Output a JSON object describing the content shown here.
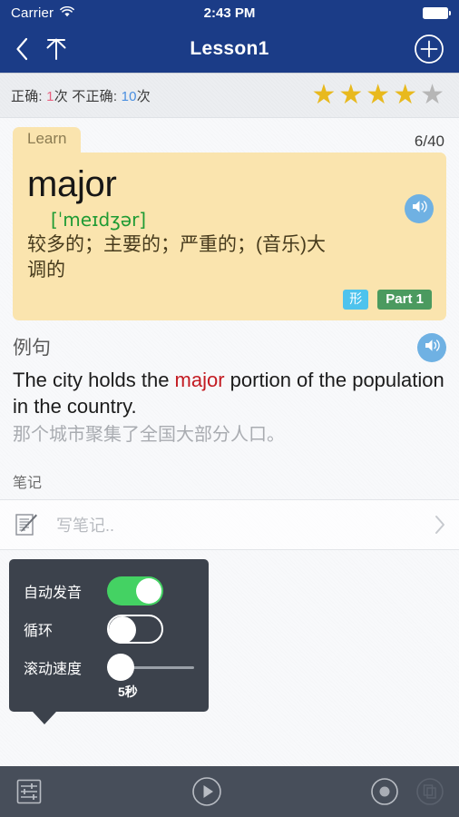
{
  "statusbar": {
    "carrier": "Carrier",
    "wifi_icon": "wifi-icon",
    "time": "2:43 PM",
    "battery_icon": "battery-full-icon"
  },
  "navbar": {
    "back_icon": "chevron-left-icon",
    "up_icon": "arrow-up-icon",
    "title": "Lesson1",
    "add_icon": "plus-circle-icon"
  },
  "stats": {
    "correct_label": "正确: ",
    "correct_count": "1",
    "correct_unit": "次 ",
    "wrong_label": "不正确: ",
    "wrong_count": "10",
    "wrong_unit": "次",
    "stars_filled": 4,
    "stars_total": 5,
    "star_glyph": "★",
    "star_color": "#e8b91e",
    "star_off_color": "#b6b6b6"
  },
  "card": {
    "tab_label": "Learn",
    "counter": "6/40",
    "word": "major",
    "phonetic": "[ˈmeɪdʒər]",
    "definition": "较多的；主要的；严重的；(音乐)大调的",
    "pos_tag": "形",
    "part_tag": "Part 1",
    "speaker_icon": "speaker-icon",
    "bg_color": "#fae4ae",
    "pos_tag_color": "#4ec3ed",
    "part_tag_color": "#4b9a5f"
  },
  "example": {
    "heading": "例句",
    "speaker_icon": "speaker-icon",
    "sentence_before": "The city holds the ",
    "sentence_highlight": "major",
    "sentence_after": " portion of the population in the country.",
    "translation": "那个城市聚集了全国大部分人口。",
    "highlight_color": "#c31b22"
  },
  "notes": {
    "heading": "笔记",
    "note_icon": "note-pencil-icon",
    "placeholder": "写笔记..",
    "chevron_icon": "chevron-right-icon"
  },
  "settings_popover": {
    "rows": [
      {
        "label": "自动发音",
        "control": "switch",
        "state": "on"
      },
      {
        "label": "循环",
        "control": "switch",
        "state": "off"
      },
      {
        "label": "滚动速度",
        "control": "slider",
        "value": "5秒",
        "position": 0
      }
    ],
    "slider_value": "5秒",
    "on_color": "#44d263",
    "bg_color": "#3c424c"
  },
  "toolbar": {
    "settings_icon": "sliders-icon",
    "play_icon": "play-circle-icon",
    "record_icon": "record-circle-icon",
    "cards_icon": "copy-cards-icon",
    "bg_color": "#474e5a"
  }
}
